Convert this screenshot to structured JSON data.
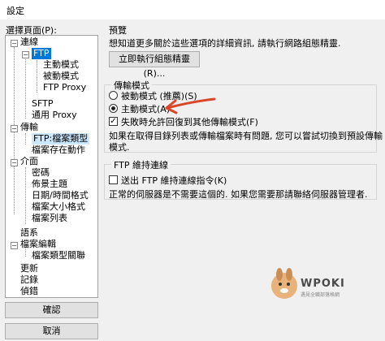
{
  "window": {
    "title": "設定"
  },
  "page_label": "選擇頁面(P):",
  "tree": {
    "items": [
      {
        "label": "連線"
      },
      {
        "label": "FTP"
      },
      {
        "label": "主動模式"
      },
      {
        "label": "被動模式"
      },
      {
        "label": "FTP Proxy"
      },
      {
        "label": "SFTP"
      },
      {
        "label": "通用 Proxy"
      },
      {
        "label": "傳輸"
      },
      {
        "label": "FTP:檔案類型"
      },
      {
        "label": "檔案存在動作"
      },
      {
        "label": "介面"
      },
      {
        "label": "密碼"
      },
      {
        "label": "佈景主題"
      },
      {
        "label": "日期/時間格式"
      },
      {
        "label": "檔案大小格式"
      },
      {
        "label": "檔案列表"
      },
      {
        "label": "語系"
      },
      {
        "label": "檔案編輯"
      },
      {
        "label": "檔案類型關聯"
      },
      {
        "label": "更新"
      },
      {
        "label": "記錄"
      },
      {
        "label": "偵錯"
      }
    ]
  },
  "buttons": {
    "ok": "確認",
    "cancel": "取消"
  },
  "overview": {
    "title": "預覽",
    "desc": "想知道更多關於這些選項的詳細資訊, 請執行網路組態精靈.",
    "button": "立即執行組態精靈(R)..."
  },
  "transfer_mode": {
    "title": "傳輸模式",
    "passive": "被動模式 (推薦)(S)",
    "active": "主動模式(A)",
    "selected": "active",
    "fallback_label": "失敗時允許回復到其他傳輸模式(F)",
    "fallback_checked": true,
    "note_line1": "如果在取得目錄列表或傳輸檔案時有問題, 您可以嘗試切換到預設傳輸",
    "note_line2": "模式."
  },
  "keepalive": {
    "title": "FTP 維持連線",
    "checkbox_label": "送出 FTP 維持連線指令(K)",
    "checked": false,
    "note": "正常的伺服器是不需要這個的. 如果您需要那請聯絡伺服器管理者."
  },
  "watermark": {
    "brand": "WPOKI",
    "sub": "遇見全職部落格網"
  },
  "colors": {
    "selection": "#0078d7",
    "highlight": "#cce8ff",
    "arrow": "#d9472b"
  }
}
